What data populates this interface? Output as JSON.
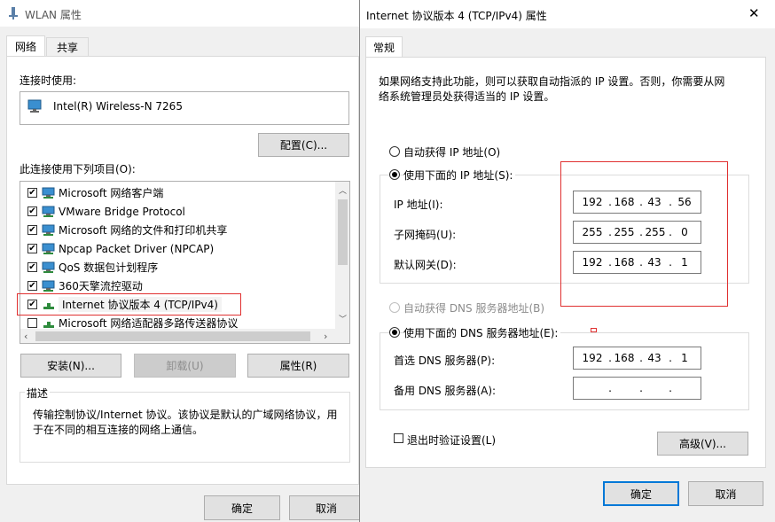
{
  "left_window": {
    "title": "WLAN 属性",
    "tabs": [
      "网络",
      "共享"
    ],
    "connect_using_label": "连接时使用:",
    "adapter_name": "Intel(R) Wireless-N 7265",
    "configure_button": "配置(C)...",
    "items_label": "此连接使用下列项目(O):",
    "items": [
      {
        "label": "Microsoft 网络客户端",
        "checked": true
      },
      {
        "label": "VMware Bridge Protocol",
        "checked": true
      },
      {
        "label": "Microsoft 网络的文件和打印机共享",
        "checked": true
      },
      {
        "label": "Npcap Packet Driver (NPCAP)",
        "checked": true
      },
      {
        "label": "QoS 数据包计划程序",
        "checked": true
      },
      {
        "label": "360天擎流控驱动",
        "checked": true
      },
      {
        "label": "Internet 协议版本 4 (TCP/IPv4)",
        "checked": true
      },
      {
        "label": "Microsoft 网络适配器多路传送器协议",
        "checked": false
      }
    ],
    "install_button": "安装(N)...",
    "uninstall_button": "卸载(U)",
    "properties_button": "属性(R)",
    "description_label": "描述",
    "description_text_1": "传输控制协议/Internet 协议。该协议是默认的广域网络协议，用",
    "description_text_2": "于在不同的相互连接的网络上通信。",
    "ok_button": "确定",
    "cancel_button": "取消"
  },
  "right_window": {
    "title": "Internet 协议版本 4 (TCP/IPv4) 属性",
    "close_glyph": "✕",
    "tab_general": "常规",
    "intro_line_1": "如果网络支持此功能，则可以获取自动指派的 IP 设置。否则，你需要从网",
    "intro_line_2": "络系统管理员处获得适当的 IP 设置。",
    "auto_ip_label": "自动获得 IP 地址(O)",
    "manual_ip_label": "使用下面的 IP 地址(S):",
    "ip_address_label": "IP 地址(I):",
    "subnet_mask_label": "子网掩码(U):",
    "gateway_label": "默认网关(D):",
    "ip_address": [
      "192",
      "168",
      "43",
      "56"
    ],
    "subnet_mask": [
      "255",
      "255",
      "255",
      "0"
    ],
    "gateway": [
      "192",
      "168",
      "43",
      "1"
    ],
    "auto_dns_label": "自动获得 DNS 服务器地址(B)",
    "manual_dns_label": "使用下面的 DNS 服务器地址(E):",
    "preferred_dns_label": "首选 DNS 服务器(P):",
    "alternate_dns_label": "备用 DNS 服务器(A):",
    "preferred_dns": [
      "192",
      "168",
      "43",
      "1"
    ],
    "alternate_dns": [
      "",
      "",
      "",
      ""
    ],
    "validate_label": "退出时验证设置(L)",
    "advanced_button": "高级(V)...",
    "ok_button": "确定",
    "cancel_button": "取消"
  },
  "colors": {
    "highlight_red": "#e03030",
    "accent_blue": "#0078d7"
  }
}
